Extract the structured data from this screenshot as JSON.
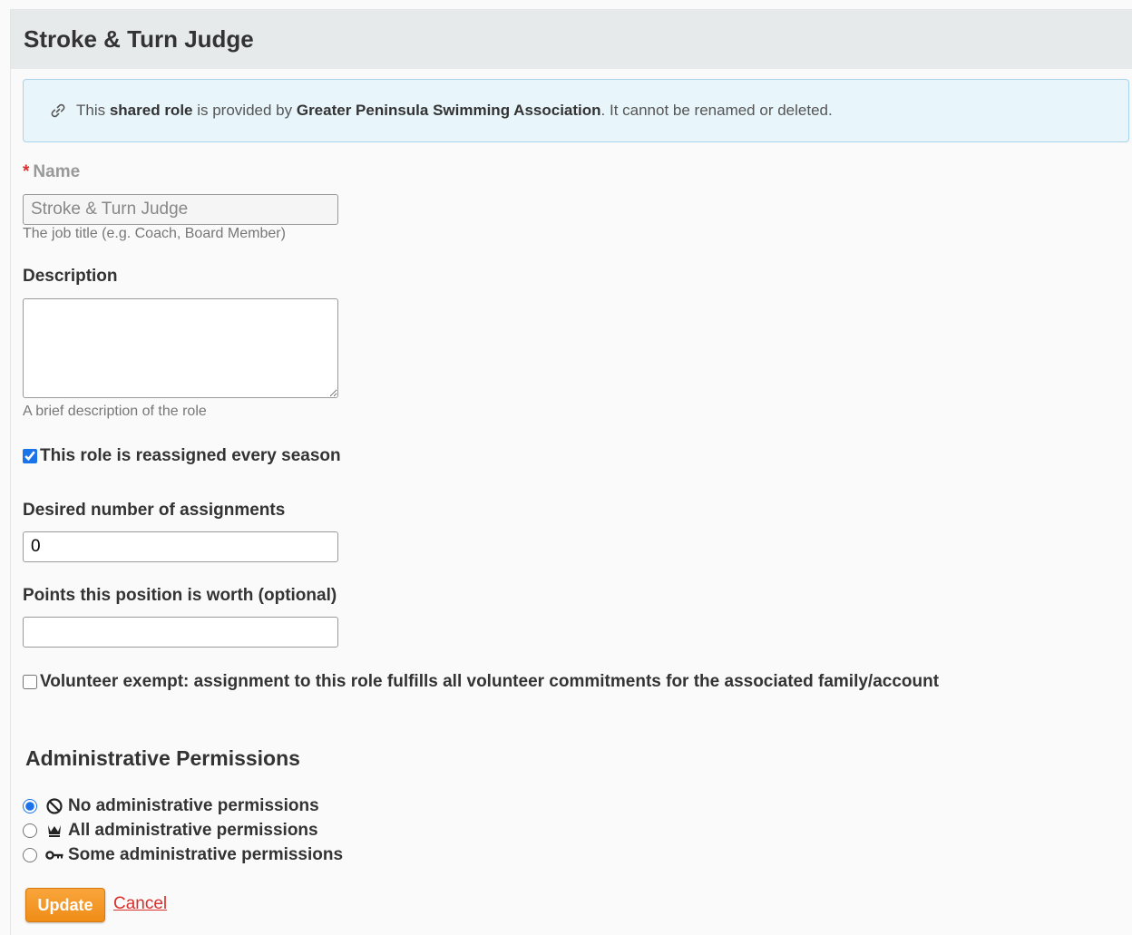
{
  "header": {
    "title": "Stroke & Turn Judge"
  },
  "info": {
    "prefix": "This ",
    "shared_role": "shared role",
    "middle": " is provided by ",
    "org": "Greater Peninsula Swimming Association",
    "suffix": ". It cannot be renamed or deleted.",
    "icon": "link-icon"
  },
  "form": {
    "name": {
      "required_mark": "*",
      "label": "Name",
      "value": "Stroke & Turn Judge",
      "help": "The job title (e.g. Coach, Board Member)"
    },
    "description": {
      "label": "Description",
      "value": "",
      "help": "A brief description of the role"
    },
    "reassigned": {
      "label": "This role is reassigned every season",
      "checked": true
    },
    "desired_assignments": {
      "label": "Desired number of assignments",
      "value": "0"
    },
    "points": {
      "label": "Points this position is worth (optional)",
      "value": ""
    },
    "volunteer_exempt": {
      "label": "Volunteer exempt: assignment to this role fulfills all volunteer commitments for the associated family/account",
      "checked": false
    }
  },
  "permissions": {
    "title": "Administrative Permissions",
    "options": [
      {
        "label": "No administrative permissions",
        "icon": "ban-icon",
        "selected": true
      },
      {
        "label": "All administrative permissions",
        "icon": "crown-icon",
        "selected": false
      },
      {
        "label": "Some administrative permissions",
        "icon": "key-icon",
        "selected": false
      }
    ]
  },
  "actions": {
    "update_label": "Update",
    "cancel_label": "Cancel"
  },
  "colors": {
    "accent": "#f39a26",
    "link": "#d9302c",
    "info_bg": "#e8f5fb",
    "header_bg": "#e6eaeb"
  }
}
